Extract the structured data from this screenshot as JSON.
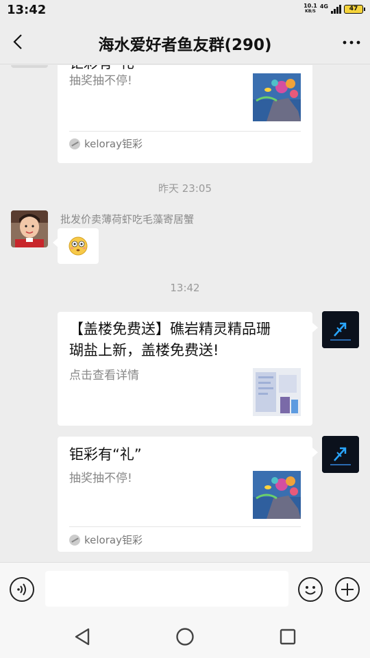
{
  "status_bar": {
    "time": "13:42",
    "speed_value": "10.1",
    "speed_unit": "KB/S",
    "network": "4G",
    "battery": "47"
  },
  "header": {
    "title": "海水爱好者鱼友群(290)"
  },
  "messages": {
    "card_top": {
      "title": "钜彩有“礼”",
      "desc": "抽奖抽不停!",
      "source": "keloray钜彩",
      "thumb_icon": "coral-reef-thumbnail"
    },
    "timestamp_1": "昨天 23:05",
    "incoming": {
      "sender": "批发价卖薄荷虾吃毛藻寄居蟹",
      "emoji": "flushed-face-emoji"
    },
    "timestamp_2": "13:42",
    "card_mid": {
      "title_line1": "【盖楼免费送】礁岩精灵精品珊",
      "title_line2": "瑚盐上新，盖楼免费送!",
      "desc": "点击查看详情",
      "thumb_icon": "salt-product-thumbnail"
    },
    "card_bottom": {
      "title": "钜彩有“礼”",
      "desc": "抽奖抽不停!",
      "source": "keloray钜彩",
      "thumb_icon": "coral-reef-thumbnail"
    }
  },
  "input_bar": {
    "voice_icon": "voice-icon",
    "emoji_icon": "emoji-icon",
    "plus_icon": "plus-icon"
  },
  "nav_bar": {
    "back": "back-triangle-icon",
    "home": "home-circle-icon",
    "recents": "recents-square-icon"
  },
  "colors": {
    "background": "#ededed",
    "bubble": "#ffffff",
    "timestamp": "#9a9a9a",
    "secondary_text": "#888888"
  }
}
